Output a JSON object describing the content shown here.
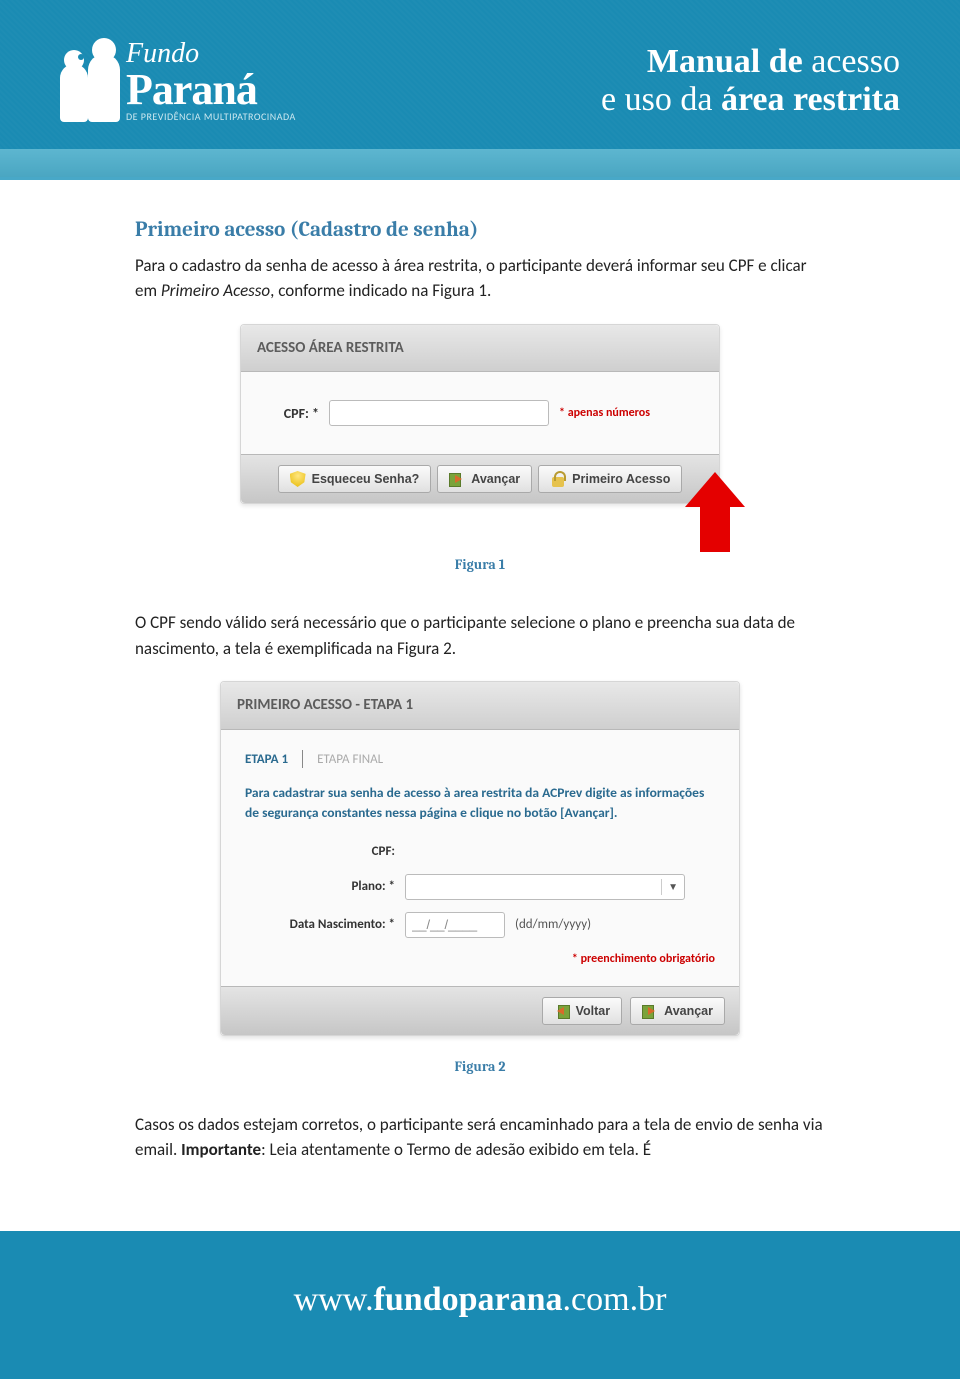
{
  "header": {
    "logo": {
      "line1": "Fundo",
      "line2": "Paraná",
      "sub": "DE PREVIDÊNCIA MULTIPATROCINADA"
    },
    "title": {
      "l1_bold": "Manual de",
      "l1_light": "acesso",
      "l2_light": "e uso da",
      "l2_bold": "área restrita"
    }
  },
  "section1": {
    "title": "Primeiro acesso (Cadastro de senha)",
    "p1_a": "Para o cadastro da senha de acesso à área restrita, o participante deverá informar seu CPF e clicar em ",
    "p1_em": "Primeiro Acesso",
    "p1_b": ", conforme indicado na Figura 1."
  },
  "figure1": {
    "panel_title": "ACESSO ÁREA RESTRITA",
    "cpf_label": "CPF: *",
    "cpf_hint": "* apenas números",
    "btn_forgot": "Esqueceu Senha?",
    "btn_next": "Avançar",
    "btn_first": "Primeiro Acesso",
    "caption": "Figura 1"
  },
  "section2": {
    "p": "O CPF sendo válido será necessário que o participante selecione o plano e preencha sua data de nascimento, a tela é exemplificada na Figura 2."
  },
  "figure2": {
    "panel_title": "PRIMEIRO ACESSO - ETAPA 1",
    "tab1": "ETAPA 1",
    "tab2": "ETAPA FINAL",
    "instructions": "Para cadastrar sua senha de acesso à area restrita da ACPrev digite as informações de segurança constantes nessa página e clique no botão [Avançar].",
    "cpf_label": "CPF:",
    "plano_label": "Plano: *",
    "dob_label": "Data Nascimento: *",
    "dob_value": "__/__/____",
    "dob_format": "(dd/mm/yyyy)",
    "mandatory": "* preenchimento obrigatório",
    "btn_back": "Voltar",
    "btn_next": "Avançar",
    "caption": "Figura 2"
  },
  "section3": {
    "p_a": "Casos os dados estejam corretos, o participante será encaminhado para a tela de envio de senha via email. ",
    "p_strong": "Importante",
    "p_b": ": Leia atentamente o Termo de adesão exibido em tela. É"
  },
  "footer": {
    "pre": "www.",
    "bold": "fundoparana",
    "post": ".com.br"
  }
}
